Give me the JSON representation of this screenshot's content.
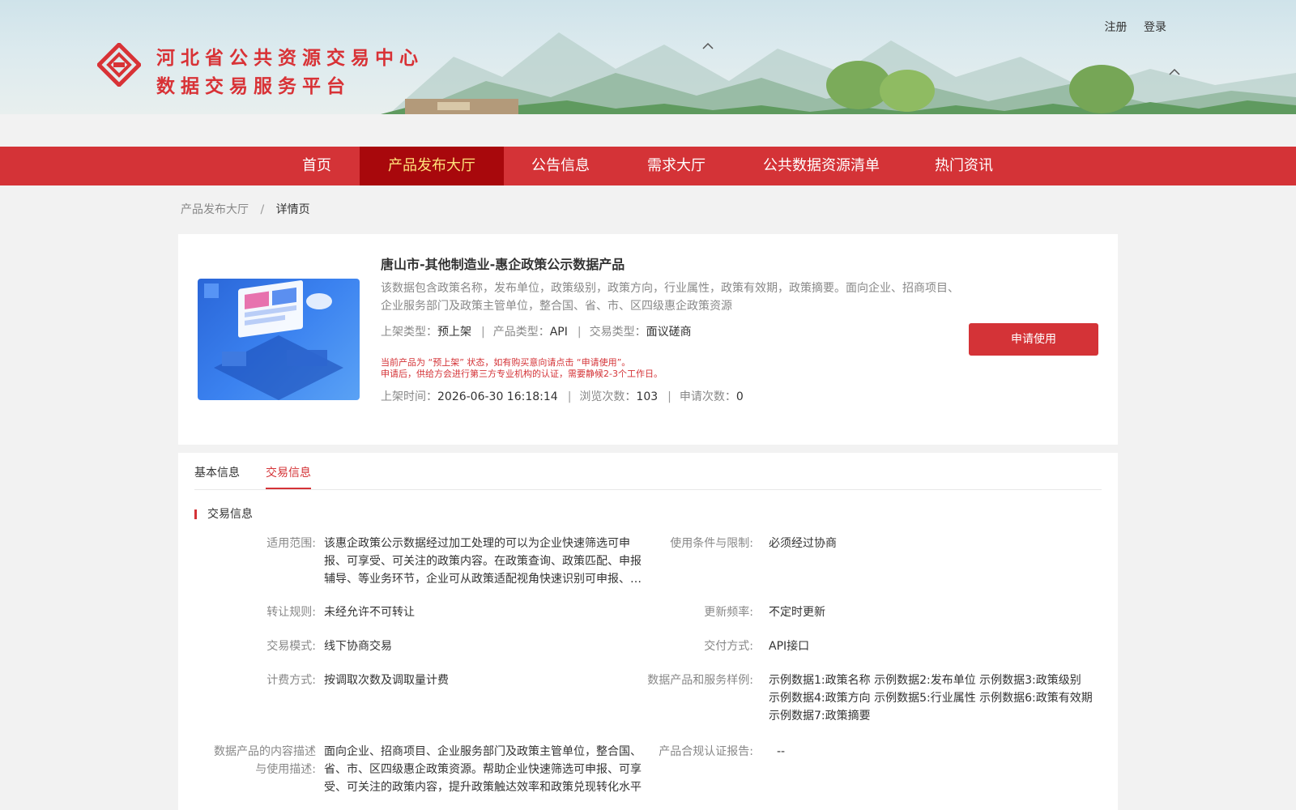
{
  "header": {
    "site_title_line1": "河北省公共资源交易中心",
    "site_title_line2": "数据交易服务平台",
    "register": "注册",
    "login": "登录"
  },
  "nav": {
    "items": [
      "首页",
      "产品发布大厅",
      "公告信息",
      "需求大厅",
      "公共数据资源清单",
      "热门资讯"
    ],
    "active": "产品发布大厅"
  },
  "breadcrumb": {
    "parent": "产品发布大厅",
    "separator": "/",
    "current": "详情页"
  },
  "product": {
    "title": "唐山市-其他制造业-惠企政策公示数据产品",
    "description": "该数据包含政策名称，发布单位，政策级别，政策方向，行业属性，政策有效期，政策摘要。面向企业、招商项目、企业服务部门及政策主管单位，整合国、省、市、区四级惠企政策资源",
    "listing_type_label": "上架类型：",
    "listing_type": "预上架",
    "product_type_label": "产品类型：",
    "product_type": "API",
    "trade_type_label": "交易类型：",
    "trade_type": "面议磋商",
    "notice_line1": "当前产品为 “预上架” 状态，如有购买意向请点击 “申请使用”。",
    "notice_line2": "申请后，供给方会进行第三方专业机构的认证，需要静候2-3个工作日。",
    "listed_time_label": "上架时间：",
    "listed_time": "2026-06-30 16:18:14",
    "views_label": "浏览次数：",
    "views": "103",
    "applications_label": "申请次数：",
    "applications": "0",
    "apply_button": "申请使用",
    "pipe": "|"
  },
  "tabs": {
    "basic": "基本信息",
    "trade": "交易信息",
    "active": "交易信息"
  },
  "trade_info": {
    "section_title": "交易信息",
    "scope_label": "适用范围:",
    "scope_value": "该惠企政策公示数据经过加工处理的可以为企业快速筛选可申报、可享受、可关注的政策内容。在政策查询、政策匹配、申报辅导、等业务环节，企业可从政策适配视角快速识别可申报、可享受的政策内容",
    "limits_label": "使用条件与限制:",
    "limits_value": "必须经过协商",
    "transfer_label": "转让规则:",
    "transfer_value": "未经允许不可转让",
    "freq_label": "更新频率:",
    "freq_value": "不定时更新",
    "mode_label": "交易模式:",
    "mode_value": "线下协商交易",
    "delivery_label": "交付方式:",
    "delivery_value": "API接口",
    "billing_label": "计费方式:",
    "billing_value": "按调取次数及调取量计费",
    "sample_label": "数据产品和服务样例:",
    "sample_value": "示例数据1:政策名称 示例数据2:发布单位 示例数据3:政策级别 示例数据4:政策方向 示例数据5:行业属性 示例数据6:政策有效期 示例数据7:政策摘要",
    "content_label_line1": "数据产品的内容描述",
    "content_label_line2": "与使用描述:",
    "content_value": "面向企业、招商项目、企业服务部门及政策主管单位，整合国、省、市、区四级惠企政策资源。帮助企业快速筛选可申报、可享受、可关注的政策内容，提升政策触达效率和政策兑现转化水平",
    "compliance_label": "产品合规认证报告:",
    "compliance_value": "--"
  },
  "colors": {
    "brand_red": "#d43337",
    "nav_active_bg": "#a8080c",
    "nav_active_text": "#ffe27a"
  }
}
